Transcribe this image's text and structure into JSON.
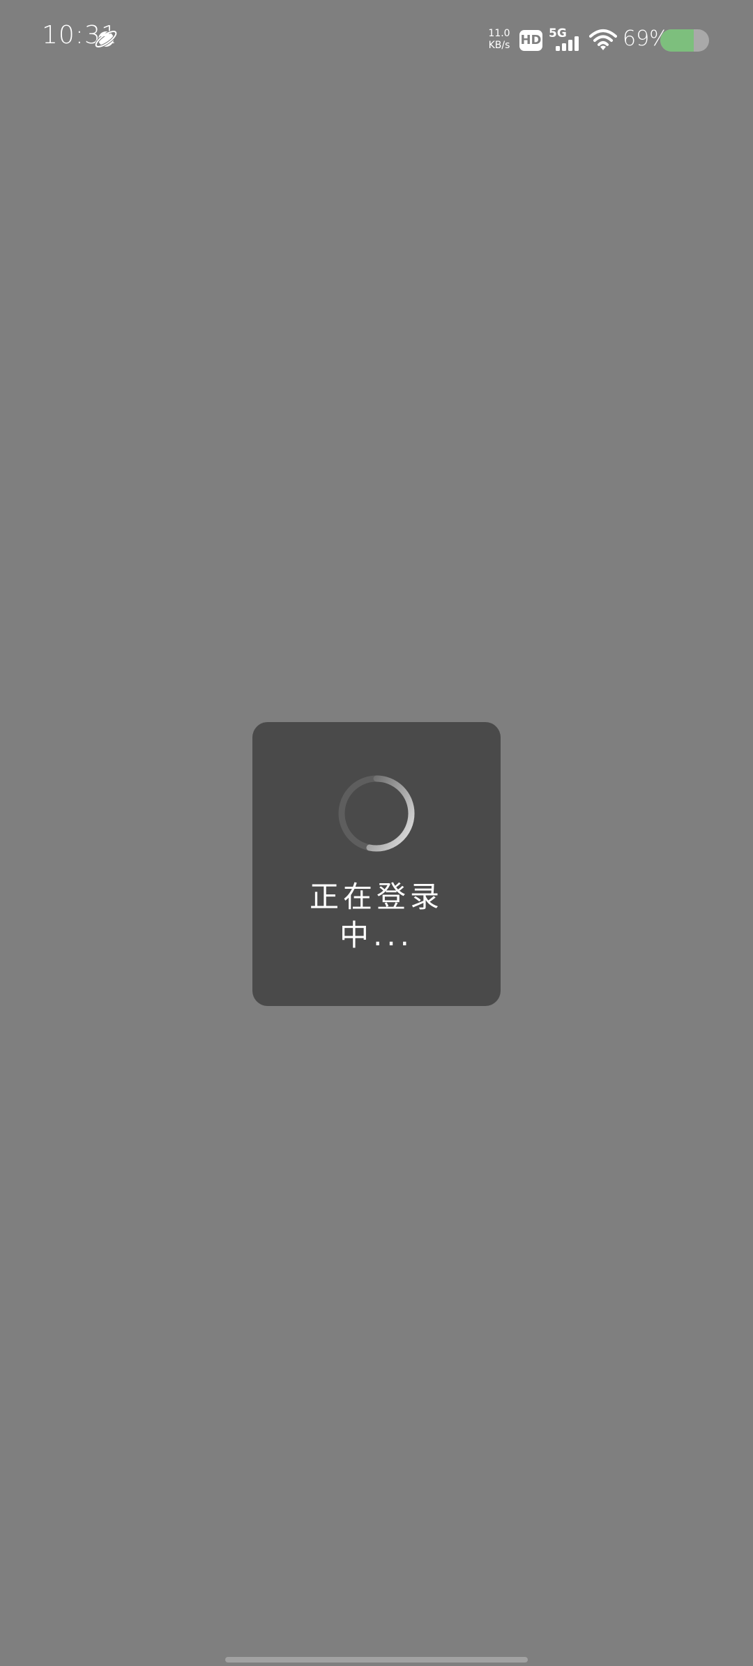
{
  "status_bar": {
    "time": "10:31",
    "app_icon": "planet-icon",
    "net_speed_value": "11.0",
    "net_speed_unit": "KB/s",
    "hd_label": "HD",
    "network_type": "5G",
    "signal_icon": "cellular-signal-icon",
    "wifi_icon": "wifi-icon",
    "battery_percent_text": "69%",
    "battery_level": 0.69,
    "battery_color": "#7dbf7d"
  },
  "loading_dialog": {
    "spinner_icon": "loading-spinner-icon",
    "message_line1": "正在登录",
    "message_line2": "中..."
  },
  "colors": {
    "background": "#7f7f7f",
    "dialog": "#4a4a4a",
    "text": "#ffffff"
  }
}
